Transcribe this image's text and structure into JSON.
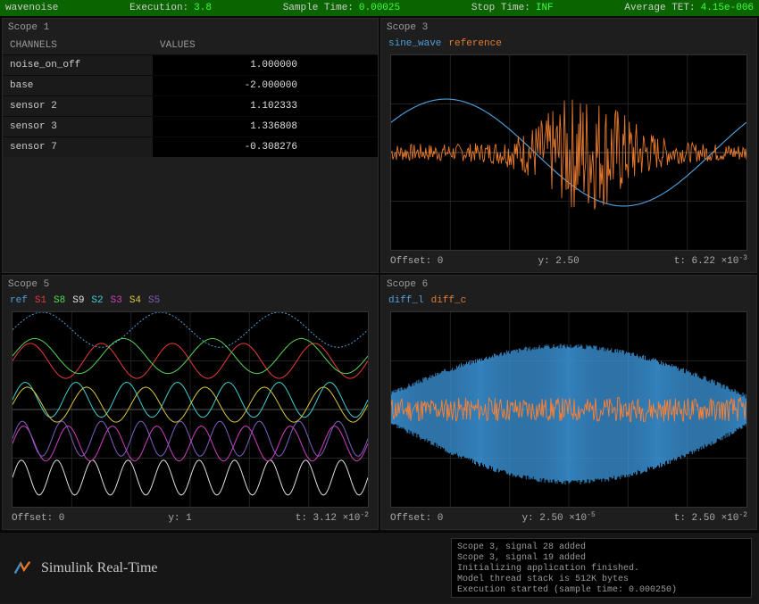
{
  "topbar": {
    "title": "wavenoise",
    "exec_label": "Execution:",
    "exec_value": "3.8",
    "sample_label": "Sample Time:",
    "sample_value": "0.00025",
    "stop_label": "Stop Time:",
    "stop_value": "INF",
    "tet_label": "Average TET:",
    "tet_value": "4.15e-006"
  },
  "scope1": {
    "title": "Scope 1",
    "headers": {
      "channels": "CHANNELS",
      "values": "VALUES"
    },
    "rows": [
      {
        "name": "noise_on_off",
        "value": "1.000000"
      },
      {
        "name": "base",
        "value": "-2.000000"
      },
      {
        "name": "sensor 2",
        "value": "1.102333"
      },
      {
        "name": "sensor 3",
        "value": "1.336808"
      },
      {
        "name": "sensor 7",
        "value": "-0.308276"
      }
    ]
  },
  "scope3": {
    "title": "Scope 3",
    "legend": [
      {
        "label": "sine_wave",
        "color": "#4e9fd8"
      },
      {
        "label": "reference",
        "color": "#e67a2e"
      }
    ],
    "footer": {
      "offset": "Offset: 0",
      "y": "y: 2.50",
      "t_prefix": "t: 6.22",
      "t_exp": "×10",
      "t_pow": "-3"
    }
  },
  "scope5": {
    "title": "Scope 5",
    "legend": [
      {
        "label": "ref",
        "color": "#4e9fd8"
      },
      {
        "label": "S1",
        "color": "#e63a3a"
      },
      {
        "label": "S8",
        "color": "#58d858"
      },
      {
        "label": "S9",
        "color": "#e0e0e0"
      },
      {
        "label": "S2",
        "color": "#40d0d0"
      },
      {
        "label": "S3",
        "color": "#d040c0"
      },
      {
        "label": "S4",
        "color": "#d8c840"
      },
      {
        "label": "S5",
        "color": "#8060c0"
      }
    ],
    "footer": {
      "offset": "Offset: 0",
      "y": "y: 1",
      "t_prefix": "t: 3.12",
      "t_exp": "×10",
      "t_pow": "-2"
    }
  },
  "scope6": {
    "title": "Scope 6",
    "legend": [
      {
        "label": "diff_l",
        "color": "#4e9fd8"
      },
      {
        "label": "diff_c",
        "color": "#e67a2e"
      }
    ],
    "footer": {
      "offset": "Offset: 0",
      "y_prefix": "y: 2.50",
      "y_exp": "×10",
      "y_pow": "-5",
      "t_prefix": "t: 2.50",
      "t_exp": "×10",
      "t_pow": "-2"
    }
  },
  "brand": "Simulink Real-Time",
  "console": {
    "l1": "Scope 3, signal 28 added",
    "l2": "Scope 3, signal 19 added",
    "l3": "Initializing application finished.",
    "l4": "Model thread stack is 512K bytes",
    "l5": "Execution started (sample time: 0.000250)"
  },
  "chart_data": [
    {
      "type": "table",
      "title": "Scope 1",
      "columns": [
        "CHANNELS",
        "VALUES"
      ],
      "rows": [
        [
          "noise_on_off",
          1.0
        ],
        [
          "base",
          -2.0
        ],
        [
          "sensor 2",
          1.102333
        ],
        [
          "sensor 3",
          1.336808
        ],
        [
          "sensor 7",
          -0.308276
        ]
      ]
    },
    {
      "type": "line",
      "title": "Scope 3",
      "xlabel": "t",
      "ylabel": "y",
      "x_range": [
        0,
        0.00622
      ],
      "y_range": [
        -2.5,
        2.5
      ],
      "series": [
        {
          "name": "sine_wave",
          "color": "#4e9fd8",
          "note": "single sine period, amplitude≈0.9, phase≈0.2"
        },
        {
          "name": "reference",
          "color": "#e67a2e",
          "note": "noisy signal, mean≈0, burst amplitude≈2 mid-trace"
        }
      ]
    },
    {
      "type": "line",
      "title": "Scope 5",
      "xlabel": "t",
      "ylabel": "y",
      "x_range": [
        0,
        0.0312
      ],
      "y_range": [
        -1,
        1
      ],
      "series": [
        {
          "name": "ref",
          "color": "#4e9fd8",
          "freq_cycles": 3,
          "amp": 0.18,
          "offset": 0.82
        },
        {
          "name": "S1",
          "color": "#e63a3a",
          "freq_cycles": 5,
          "amp": 0.18,
          "offset": 0.5
        },
        {
          "name": "S8",
          "color": "#58d858",
          "freq_cycles": 4,
          "amp": 0.18,
          "offset": 0.55
        },
        {
          "name": "S9",
          "color": "#e0e0e0",
          "freq_cycles": 10,
          "amp": 0.18,
          "offset": -0.7
        },
        {
          "name": "S2",
          "color": "#40d0d0",
          "freq_cycles": 7,
          "amp": 0.18,
          "offset": 0.1
        },
        {
          "name": "S3",
          "color": "#d040c0",
          "freq_cycles": 8,
          "amp": 0.18,
          "offset": -0.35
        },
        {
          "name": "S4",
          "color": "#d8c840",
          "freq_cycles": 6,
          "amp": 0.18,
          "offset": 0.05
        },
        {
          "name": "S5",
          "color": "#8060c0",
          "freq_cycles": 9,
          "amp": 0.18,
          "offset": -0.3
        }
      ]
    },
    {
      "type": "line",
      "title": "Scope 6",
      "xlabel": "t",
      "ylabel": "y",
      "x_range": [
        0,
        0.025
      ],
      "y_range": [
        -2.5e-05,
        2.5e-05
      ],
      "series": [
        {
          "name": "diff_l",
          "color": "#4e9fd8",
          "note": "sine-shaped thick band envelope, amplitude≈1.8e-5"
        },
        {
          "name": "diff_c",
          "color": "#e67a2e",
          "note": "noise centered at 0, amplitude≈0.4e-5"
        }
      ]
    }
  ]
}
